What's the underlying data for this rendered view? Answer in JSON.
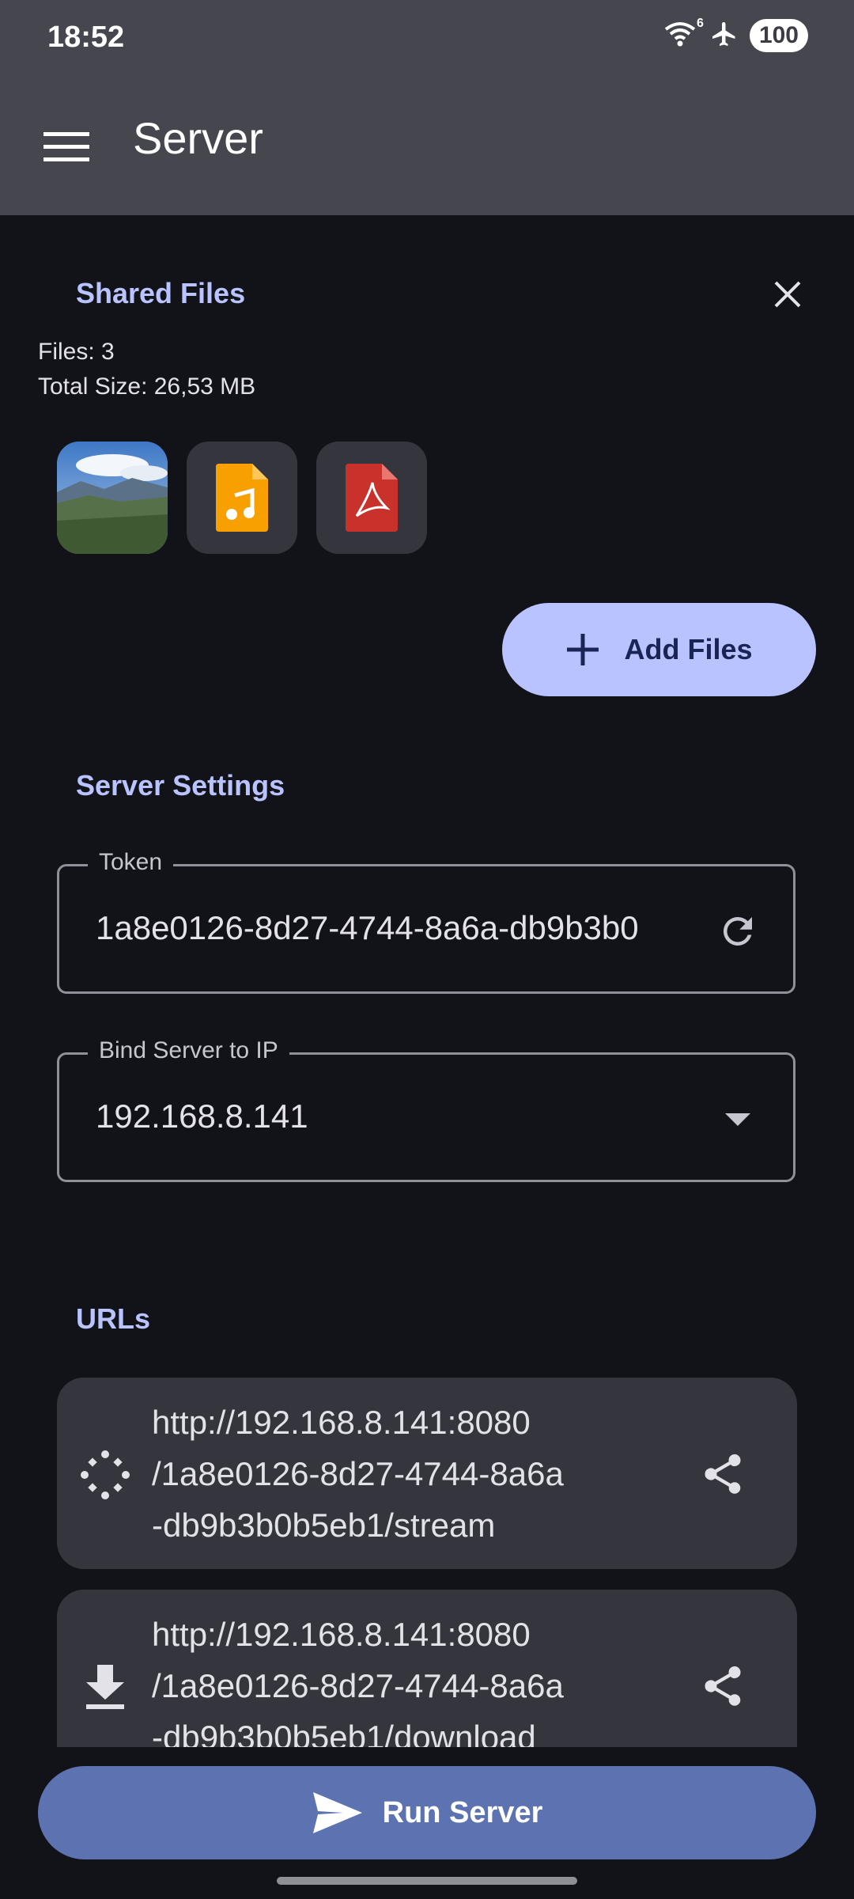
{
  "status_bar": {
    "time": "18:52",
    "wifi_badge": "6",
    "battery": "100"
  },
  "app_bar": {
    "title": "Server",
    "menu_icon": "hamburger-menu-icon"
  },
  "shared_files": {
    "title": "Shared Files",
    "files_count": "Files: 3",
    "total_size": "Total Size: 26,53 MB",
    "items": [
      {
        "type": "image",
        "icon": "landscape-thumbnail"
      },
      {
        "type": "audio",
        "icon": "audio-file-icon"
      },
      {
        "type": "pdf",
        "icon": "pdf-file-icon"
      }
    ],
    "add_button_label": "Add Files"
  },
  "server_settings": {
    "title": "Server Settings",
    "token_label": "Token",
    "token_value": "1a8e0126-8d27-4744-8a6a-db9b3b0",
    "bind_label": "Bind Server to IP",
    "bind_value": "192.168.8.141"
  },
  "urls": {
    "title": "URLs",
    "items": [
      {
        "icon": "stream-icon",
        "lines": [
          "http://192.168.8.141:8080",
          "/1a8e0126-8d27-4744-8a6a",
          "-db9b3b0b5eb1/stream"
        ]
      },
      {
        "icon": "download-icon",
        "lines": [
          "http://192.168.8.141:8080",
          "/1a8e0126-8d27-4744-8a6a",
          "-db9b3b0b5eb1/download"
        ]
      }
    ]
  },
  "run_button_label": "Run Server",
  "colors": {
    "accent": "#b9c3ff",
    "run_button": "#5c72b1",
    "background": "#121318",
    "appbar": "#45464e"
  }
}
